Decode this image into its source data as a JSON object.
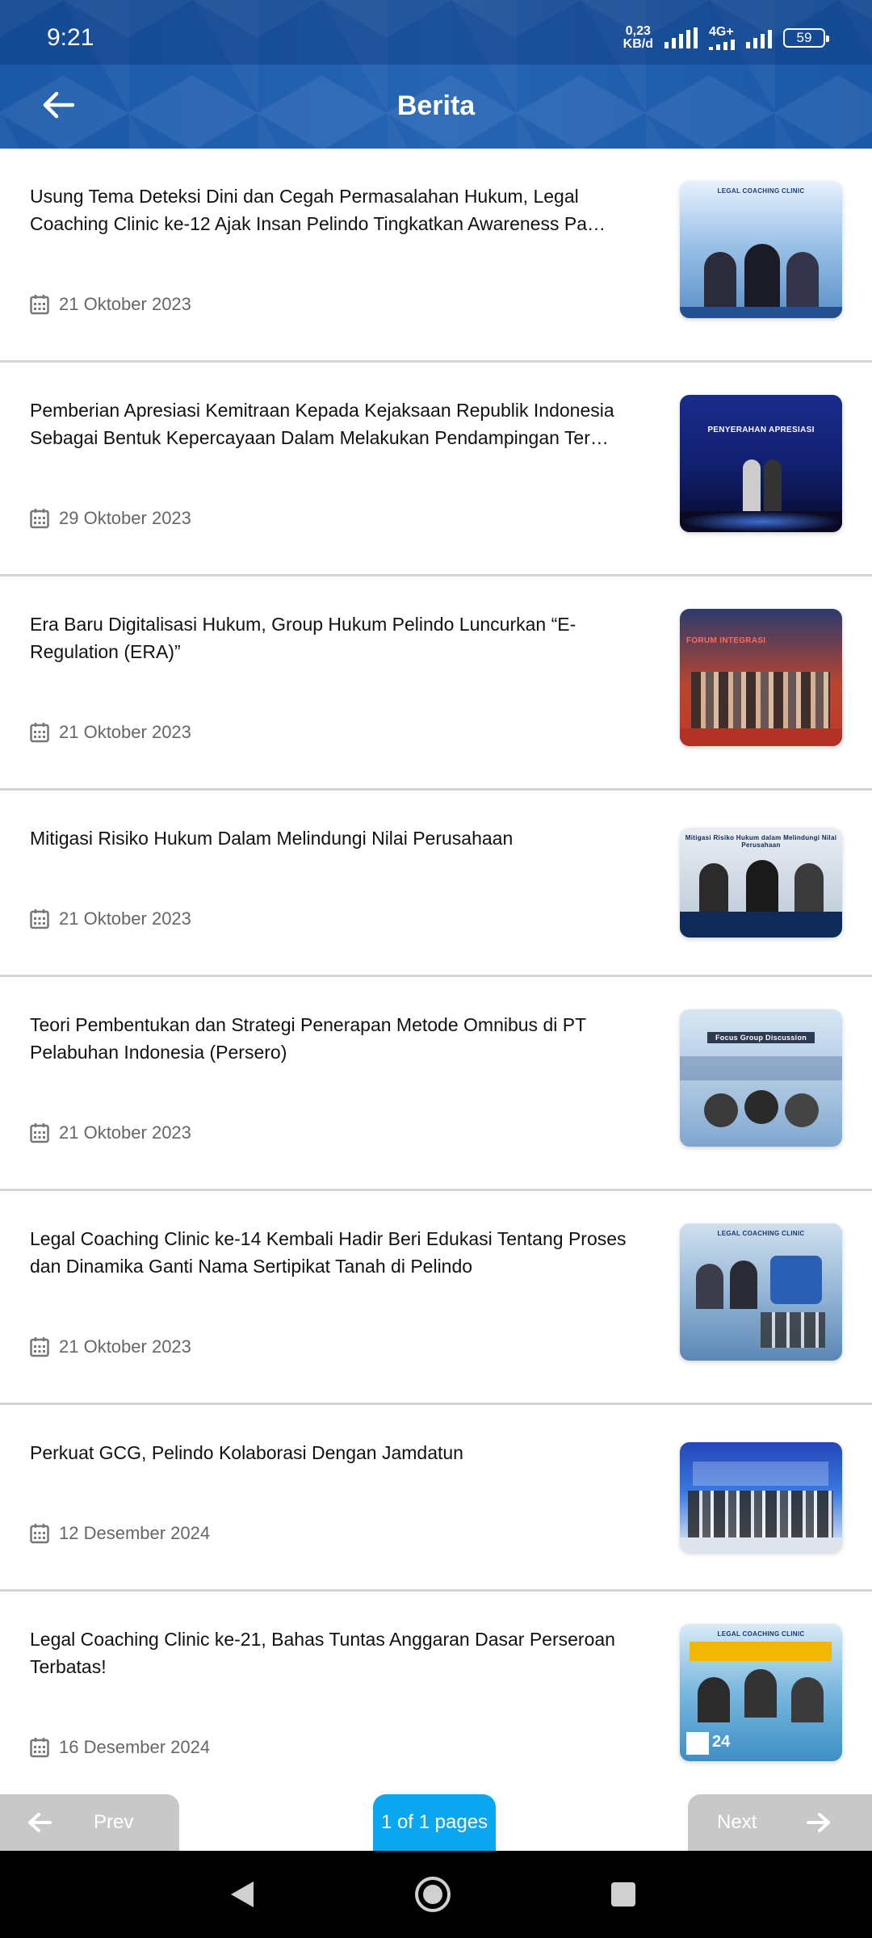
{
  "status_bar": {
    "time": "9:21",
    "net_speed_value": "0,23",
    "net_speed_unit": "KB/d",
    "net_type": "4G+",
    "battery": "59"
  },
  "header": {
    "title": "Berita",
    "back_icon": "arrow-left-icon"
  },
  "news": [
    {
      "title": "Usung Tema Deteksi Dini dan Cegah Permasalahan Hukum, Legal Coaching Clinic ke-12 Ajak Insan Pelindo Tingkatkan Awareness Pa…",
      "date": "21 Oktober 2023",
      "thumb_caption": "LEGAL COACHING CLINIC"
    },
    {
      "title": "Pemberian Apresiasi Kemitraan Kepada Kejaksaan Republik Indonesia Sebagai Bentuk Kepercayaan Dalam Melakukan Pendampingan Ter…",
      "date": "29 Oktober 2023",
      "thumb_caption": "PENYERAHAN APRESIASI"
    },
    {
      "title": "Era Baru Digitalisasi Hukum, Group Hukum Pelindo Luncurkan “E-Regulation (ERA)”",
      "date": "21 Oktober 2023",
      "thumb_caption": "FORUM INTEGRASI"
    },
    {
      "title": "Mitigasi Risiko Hukum Dalam Melindungi Nilai Perusahaan",
      "date": "21 Oktober 2023",
      "thumb_caption": "Mitigasi Risiko Hukum dalam Melindungi Nilai Perusahaan"
    },
    {
      "title": "Teori Pembentukan dan Strategi Penerapan Metode Omnibus di PT Pelabuhan Indonesia (Persero)",
      "date": "21 Oktober 2023",
      "thumb_caption": "Focus Group Discussion"
    },
    {
      "title": "Legal Coaching Clinic ke-14 Kembali Hadir Beri Edukasi Tentang Proses dan Dinamika Ganti Nama Sertipikat Tanah di Pelindo",
      "date": "21 Oktober 2023",
      "thumb_caption": "LEGAL COACHING CLINIC"
    },
    {
      "title": "Perkuat GCG, Pelindo Kolaborasi Dengan Jamdatun",
      "date": "12 Desember 2024",
      "thumb_caption": ""
    },
    {
      "title": "Legal Coaching Clinic  ke-21, Bahas Tuntas Anggaran Dasar Perseroan Terbatas!",
      "date": "16 Desember 2024",
      "thumb_caption": "LEGAL COACHING CLINIC"
    }
  ],
  "pagination": {
    "prev_label": "Prev",
    "next_label": "Next",
    "page_indicator": "1 of 1 pages"
  },
  "colors": {
    "header": "#1e5aa8",
    "page_indicator": "#0aa6ef",
    "pager_disabled": "#c8c8c8"
  }
}
